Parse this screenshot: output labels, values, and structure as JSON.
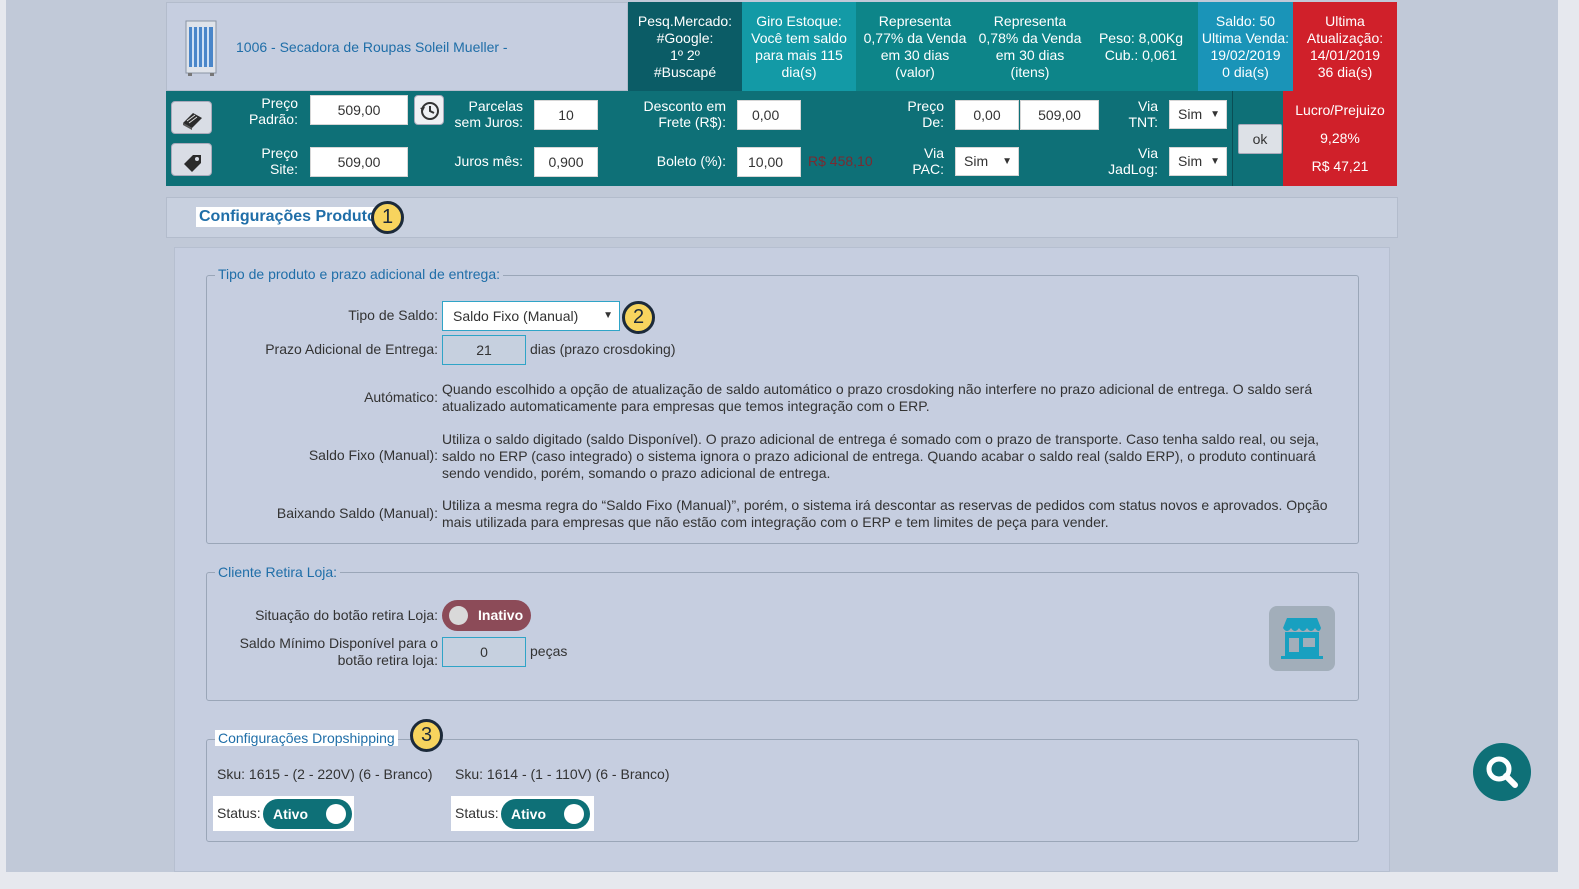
{
  "product": {
    "name": "1006 - Secadora de Roupas Soleil Mueller -"
  },
  "header_cells": {
    "pesq": [
      "Pesq.Mercado:",
      "#Google:",
      "1º 2º",
      "#Buscapé"
    ],
    "giro": [
      "Giro Estoque:",
      "Você tem saldo",
      "para mais 115",
      "dia(s)"
    ],
    "rep_valor": [
      "Representa",
      "0,77% da Venda",
      "em 30 dias",
      "(valor)"
    ],
    "rep_itens": [
      "Representa",
      "0,78% da Venda",
      "em 30 dias",
      "(itens)"
    ],
    "peso": [
      "Peso: 8,00Kg",
      "Cub.: 0,061"
    ],
    "saldo": [
      "Saldo: 50",
      "Ultima Venda:",
      "19/02/2019",
      "0 dia(s)"
    ],
    "atualizacao": [
      "Ultima",
      "Atualização:",
      "14/01/2019",
      "36 dia(s)"
    ]
  },
  "toolbar": {
    "preco_padrao_label": [
      "Preço",
      "Padrão:"
    ],
    "preco_padrao": "509,00",
    "preco_site_label": [
      "Preço",
      "Site:"
    ],
    "preco_site": "509,00",
    "parcelas_label": [
      "Parcelas",
      "sem Juros:"
    ],
    "parcelas": "10",
    "juros_label": "Juros mês:",
    "juros": "0,900",
    "desconto_label": [
      "Desconto em",
      "Frete (R$):"
    ],
    "desconto": "0,00",
    "boleto_label": "Boleto (%):",
    "boleto": "10,00",
    "boleto_valor": "R$ 458,10",
    "preco_de_label": [
      "Preço",
      "De:"
    ],
    "preco_de_1": "0,00",
    "preco_de_2": "509,00",
    "via_pac_label": [
      "Via",
      "PAC:"
    ],
    "via_pac": "Sim",
    "via_tnt_label": [
      "Via",
      "TNT:"
    ],
    "via_tnt": "Sim",
    "via_jadlog_label": [
      "Via",
      "JadLog:"
    ],
    "via_jadlog": "Sim",
    "ok_label": "ok",
    "lucro_title": "Lucro/Prejuizo",
    "lucro_pct": "9,28%",
    "lucro_valor": "R$ 47,21"
  },
  "section": {
    "title": "Configurações Produto",
    "badge1": "1",
    "badge2": "2",
    "badge3": "3"
  },
  "tipo_produto": {
    "legend": "Tipo de produto e prazo adicional de entrega:",
    "tipo_saldo_label": "Tipo de Saldo:",
    "tipo_saldo_value": "Saldo Fixo (Manual)",
    "prazo_label": "Prazo Adicional de Entrega:",
    "prazo_value": "21",
    "prazo_suffix": "dias (prazo crosdoking)",
    "automatico_label": "Autómatico:",
    "automatico_text": "Quando escolhido a opção de atualização de saldo automático o prazo crosdoking não interfere no prazo adicional de entrega. O saldo será atualizado automaticamente para empresas que temos integração com o ERP.",
    "fixo_label": "Saldo Fixo (Manual):",
    "fixo_text": "Utiliza o saldo digitado (saldo Disponível). O prazo adicional de entrega é somado com o prazo de transporte. Caso tenha saldo real, ou seja, saldo no ERP (caso integrado) o sistema ignora o prazo adicional de entrega. Quando acabar o saldo real (saldo ERP), o produto continuará sendo vendido, porém, somando o prazo adicional de entrega.",
    "baixando_label": "Baixando Saldo (Manual):",
    "baixando_text": "Utiliza a mesma regra do “Saldo Fixo (Manual)”, porém, o sistema irá descontar as reservas de pedidos com status novos e aprovados. Opção mais utilizada para empresas que não estão com integração com o ERP e tem limites de peça para vender."
  },
  "retira": {
    "legend": "Cliente Retira Loja:",
    "situacao_label": "Situação do botão retira Loja:",
    "situacao_value": "Inativo",
    "saldo_min_label": [
      "Saldo Mínimo Disponível para o",
      "botão retira loja:"
    ],
    "saldo_min_value": "0",
    "saldo_min_suffix": "peças"
  },
  "dropshipping": {
    "legend": "Configurações Dropshipping",
    "items": [
      {
        "sku": "Sku: 1615 - (2 - 220V) (6 - Branco)",
        "status_label": "Status:",
        "status": "Ativo"
      },
      {
        "sku": "Sku: 1614 - (1 - 110V) (6 - Branco)",
        "status_label": "Status:",
        "status": "Ativo"
      }
    ]
  },
  "colors": {
    "teal": "#0e7077",
    "cyan": "#0e9aa7",
    "blue": "#1a94b8",
    "red": "#d0202a"
  }
}
